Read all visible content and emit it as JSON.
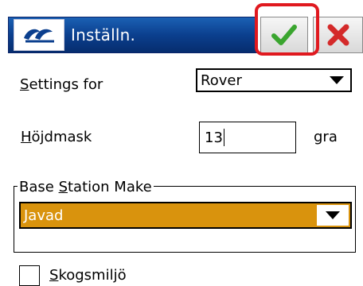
{
  "titlebar": {
    "title": "Inställn.",
    "ok_icon": "check-icon",
    "cancel_icon": "close-icon",
    "colors": {
      "title_bg": "#0b3f8e",
      "ok": "#3aa52f",
      "cancel": "#d42a2a",
      "highlight": "#e0191f"
    }
  },
  "settings_for": {
    "label_first": "S",
    "label_rest": "ettings for",
    "value": "Rover"
  },
  "elevation_mask": {
    "label_first": "H",
    "label_rest": "öjdmask",
    "value": "13",
    "unit": "gra"
  },
  "base_station": {
    "legend_a": "Base ",
    "legend_u": "S",
    "legend_b": "tation Make",
    "value": "Javad",
    "accent": "#d9930d"
  },
  "forest_env": {
    "label_first": "S",
    "label_rest": "kogsmiljö",
    "checked": false
  }
}
